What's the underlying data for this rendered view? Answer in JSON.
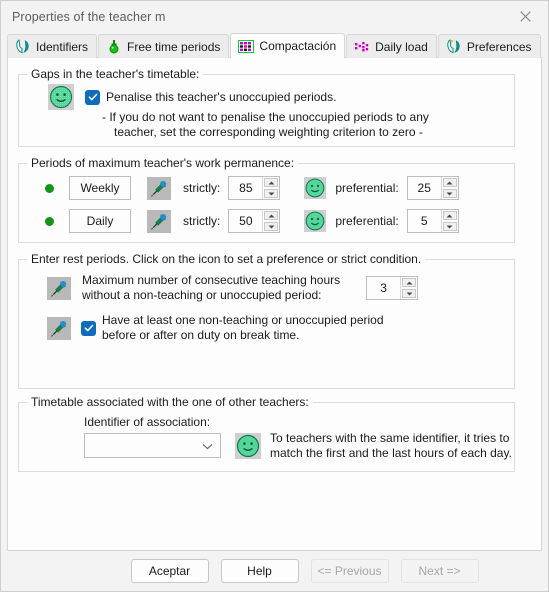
{
  "window": {
    "title": "Properties of the teacher m",
    "close_icon": "close-icon"
  },
  "tabs": [
    {
      "label": "Identifiers",
      "icon": "parrot-teal-icon",
      "selected": false
    },
    {
      "label": "Free time periods",
      "icon": "green-pin-icon",
      "selected": false
    },
    {
      "label": "Compactación",
      "icon": "magenta-grid-icon",
      "selected": true
    },
    {
      "label": "Daily load",
      "icon": "magenta-dots-icon",
      "selected": false
    },
    {
      "label": "Preferences",
      "icon": "parrot-yellow-icon",
      "selected": false
    }
  ],
  "groups": {
    "gaps": {
      "legend": "Gaps in the teacher's timetable:",
      "smiley_icon": "smiley-face-icon",
      "checkbox_label": "Penalise this teacher's unoccupied periods.",
      "checkbox_checked": true,
      "note_line1": "- If you do not want to penalise the unoccupied periods to any",
      "note_line2": "teacher, set the corresponding weighting criterion to zero -"
    },
    "permanence": {
      "legend": "Periods of maximum teacher's work permanence:",
      "rows": [
        {
          "led": "green-led-icon",
          "scope": "Weekly",
          "pin_icon": "pushpin-icon",
          "strict_label": "strictly:",
          "strict_value": "85",
          "smiley_icon": "smiley-face-icon",
          "pref_label": "preferential:",
          "pref_value": "25"
        },
        {
          "led": "green-led-icon",
          "scope": "Daily",
          "pin_icon": "pushpin-icon",
          "strict_label": "strictly:",
          "strict_value": "50",
          "smiley_icon": "smiley-face-icon",
          "pref_label": "preferential:",
          "pref_value": "5"
        }
      ]
    },
    "rest": {
      "legend": "Enter rest periods.  Click on the icon to set a preference or strict condition.",
      "max_consecutive": {
        "pin_icon": "pushpin-icon",
        "label_line1": "Maximum number of consecutive teaching hours",
        "label_line2": "without a non-teaching or unoccupied period:",
        "value": "3"
      },
      "break_rule": {
        "pin_icon": "pushpin-icon",
        "checkbox_checked": true,
        "label_line1": "Have at least one non-teaching or unoccupied period",
        "label_line2": "before or after on duty on break time."
      }
    },
    "association": {
      "legend": "Timetable associated with the one of other teachers:",
      "identifier_label": "Identifier of association:",
      "identifier_value": "",
      "dropdown_icon": "chevron-down-icon",
      "smiley_icon": "smiley-face-icon",
      "note_line1": "To teachers with the same identifier, it tries to",
      "note_line2": "match the first and the last hours of each day."
    }
  },
  "footer": {
    "buttons": [
      {
        "label": "Aceptar",
        "disabled": false
      },
      {
        "label": "Help",
        "disabled": false
      },
      {
        "label": "<= Previous",
        "disabled": true
      },
      {
        "label": "Next =>",
        "disabled": true
      }
    ]
  },
  "colors": {
    "accent_blue": "#0f6cbd",
    "led_green": "#149414",
    "smiley_green": "#3fcf8f",
    "tab_magenta": "#cc00cc",
    "tab_teal": "#009999"
  }
}
